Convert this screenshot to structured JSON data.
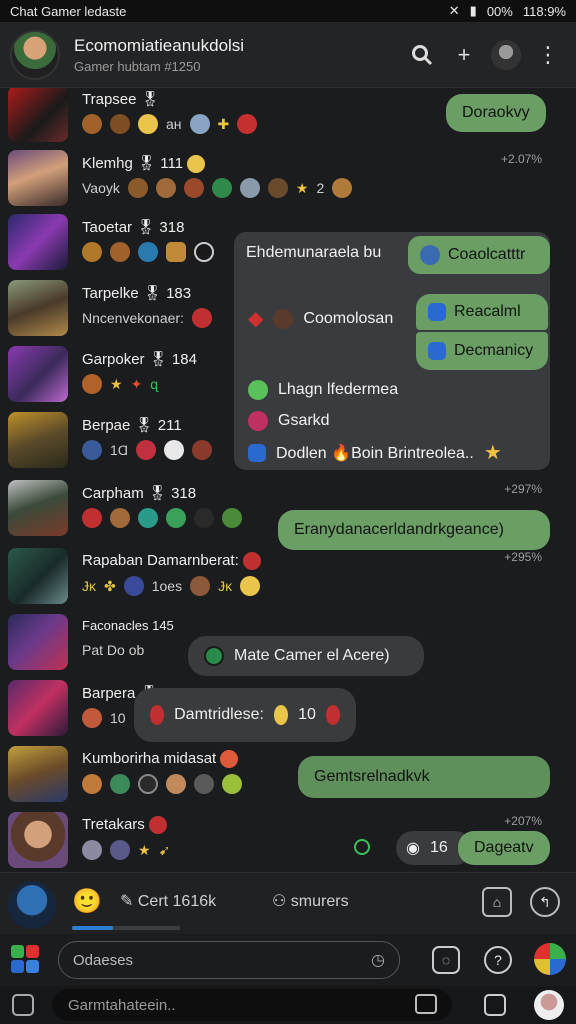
{
  "status_bar": {
    "title": "Chat Gamer ledaste",
    "battery": "00%",
    "time": "118:9%"
  },
  "app_bar": {
    "title": "Ecomomiatieanukdolsi",
    "subtitle": "Gamer hubtam #1250"
  },
  "chats": [
    {
      "name": "Trapsee 🎖",
      "sub": "ан",
      "time": ""
    },
    {
      "name": "Klemhg 🎖 111",
      "sub": "Vaoyk",
      "time": "+2.07%"
    },
    {
      "name": "Taoetar 🎖 318",
      "sub": "",
      "time": ""
    },
    {
      "name": "Tarpelke 🎖 183",
      "sub": "Nncenvekonaer:",
      "time": ""
    },
    {
      "name": "Garpoker 🎖 184",
      "sub": "",
      "time": ""
    },
    {
      "name": "Berpae 🎖 211",
      "sub": "1Ɑ",
      "time": ""
    },
    {
      "name": "Carpham 🎖 318",
      "sub": "",
      "time": "+297%"
    },
    {
      "name": "Rapaban Damarnberat:",
      "sub": "1oes",
      "time": "+295%"
    },
    {
      "name": "Faconacles 145",
      "sub": "Pat  Do ob",
      "time": ""
    },
    {
      "name": "Barpera 🎖 318",
      "sub": "10",
      "time": ""
    },
    {
      "name": "Kumborirha midasat",
      "sub": "",
      "time": ""
    },
    {
      "name": "Tretakars",
      "sub": "",
      "time": "+207%"
    }
  ],
  "bubbles": {
    "b1": "Doraokvy",
    "b2": "Eranydanacerldandrkgeance)",
    "b3": "Mate Camer el Acere)",
    "b4": "Damtridlese:",
    "b4_count": "10",
    "b5": "Gemtsrelnadkvk",
    "b6_count": "16",
    "b6": "Dageatv"
  },
  "popup": {
    "title": "Ehdemunaraela bu",
    "chip1": "Coaolcatttr",
    "item_gem": "Coomolosan",
    "chip2": "Reacalml",
    "chip3": "Decmanicy",
    "item1": "Lhagn lfedermea",
    "item2": "Gsarkd",
    "item3": "Dodlen 🔥Boin Brintreolea.."
  },
  "composer": {
    "field": "Cert 1616k",
    "people": "smurers",
    "progress_pct": 38
  },
  "input": {
    "placeholder": "Odaeses"
  },
  "nav": {
    "field": "Garmtahateein.."
  },
  "colors": {
    "accent_green": "#6b9e65",
    "bg": "#1b1c1e"
  }
}
